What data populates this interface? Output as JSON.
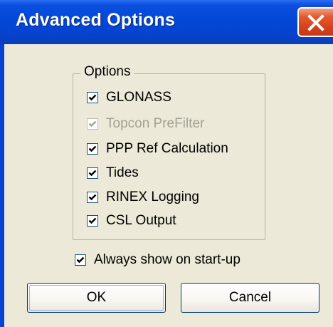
{
  "window": {
    "title": "Advanced Options",
    "close_icon": "close-icon"
  },
  "options_group": {
    "legend": "Options",
    "items": [
      {
        "label": "GLONASS",
        "checked": true,
        "enabled": true
      },
      {
        "label": "Topcon PreFilter",
        "checked": true,
        "enabled": false
      },
      {
        "label": "PPP Ref Calculation",
        "checked": true,
        "enabled": true
      },
      {
        "label": "Tides",
        "checked": true,
        "enabled": true
      },
      {
        "label": "RINEX Logging",
        "checked": true,
        "enabled": true
      },
      {
        "label": "CSL Output",
        "checked": true,
        "enabled": true
      }
    ]
  },
  "always_show": {
    "label": "Always show on start-up",
    "checked": true
  },
  "buttons": {
    "ok_label": "OK",
    "cancel_label": "Cancel"
  },
  "colors": {
    "titlebar": "#0347d6",
    "close_button": "#d8401a",
    "dialog_background": "#ece9d8",
    "disabled_text": "#a3a294"
  }
}
